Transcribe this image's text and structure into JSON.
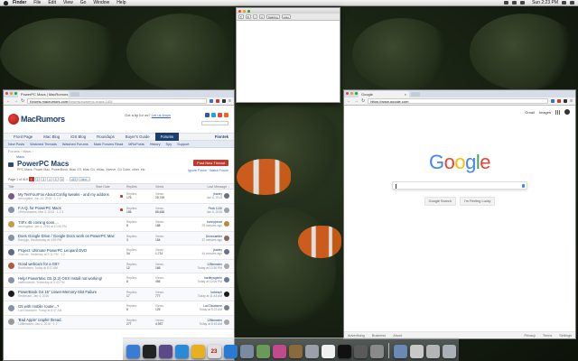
{
  "menubar": {
    "items": [
      "Finder",
      "File",
      "Edit",
      "View",
      "Go",
      "Window",
      "Help"
    ],
    "clock": "Sun 2:23 PM"
  },
  "textedit": {
    "toolbar": [
      "¶",
      "B",
      "I",
      "U",
      "Spacing",
      "Lists"
    ]
  },
  "left_browser": {
    "tab_title": "PowerPC Macs | MacRumors",
    "url_host": "forums.macrumors.com",
    "url_path": "/forums/powerpc-macs.145/",
    "site": {
      "name": "MacRumors",
      "tip_text": "Got a tip for us?",
      "tip_link": "Let us know",
      "nav_primary": [
        "Front Page",
        "Mac Blog",
        "iOS Blog",
        "Roundups",
        "Buyer's Guide",
        "Forums"
      ],
      "nav_active": "Forums",
      "user": "Finntek",
      "nav_secondary": [
        "New Posts",
        "Watched Threads",
        "Watched Forums",
        "Mark Forums Read",
        "MRoPosts",
        "History",
        "Spy",
        "Support"
      ]
    },
    "breadcrumb": "Forums › Macs ›",
    "sub_breadcrumb": "Macs",
    "forum": {
      "title": "PowerPC Macs",
      "description": "PPC Macs: Power Mac, PowerBook, iMac G3, iMac G4, eMac, Xserve, G4 Cube, other, etc.",
      "post_button": "Post New Thread",
      "ignore_link": "Ignore Forum · Watch Forum"
    },
    "pager": {
      "label": "Page 1 of 419",
      "pages": [
        "1",
        "2",
        "3",
        "4",
        "5",
        "6",
        "…",
        "419",
        "Next ›"
      ]
    },
    "table_head": [
      "Title",
      "Start Date",
      "Replies",
      "Views",
      "Last Message ↓"
    ],
    "threads": [
      {
        "title": "My TenFourFox About:Config tweaks - and my addons",
        "meta": "avuvugabd, Jun 14, 2015 · 1 2 3",
        "replies": "176",
        "views": "25,749",
        "last_user": "jbarley",
        "last_time": "Jan 6, 2013",
        "pinned": true,
        "avatar": "#7a5a8a",
        "lav": "#6a6f8a"
      },
      {
        "title": "F.A.Q. for PowerPC Macs",
        "meta": "1Rrtonoracles, Mar 3, 2013 · 1 2 3",
        "replies": "156",
        "views": "85,636",
        "last_user": "Peck 1130",
        "last_time": "Jan 5, 2015",
        "pinned": true,
        "avatar": "#8892a6",
        "lav": "#9aa3b5"
      },
      {
        "title": "T4Fx 45 coming soon....",
        "meta": "avuvugabd, Jan 4, 2016 at 10:06 PM",
        "replies": "8",
        "views": "188",
        "last_user": "bunnypecat",
        "last_time": "29 minutes ago",
        "pinned": false,
        "avatar": "#c79a4a",
        "lav": "#b58a3c"
      },
      {
        "title": "Does Google Drive / Google Docs work on PowerPC Mac",
        "meta": "Ramjuju, Wednesday at 4:59 PM",
        "replies": "3",
        "views": "154",
        "last_user": "Drcrecaetter",
        "last_time": "37 minutes ago",
        "pinned": false,
        "avatar": "#8892a6",
        "lav": "#8a6a5a"
      },
      {
        "title": "Project: Ultimate PowerPC Leopard DVD",
        "meta": "Ghovrie, Yesterday at 9:11 PM · 1 2",
        "replies": "34",
        "views": "1,714",
        "last_user": "jbarley",
        "last_time": "44 minutes ago",
        "pinned": false,
        "avatar": "#5a6a8a",
        "lav": "#6a6f8a"
      },
      {
        "title": "Good webcam for a G5?",
        "meta": "Rubthulsen, Today at 8:17 AM",
        "replies": "12",
        "views": "166",
        "last_user": "128kmaxim",
        "last_time": "Today at 12:30 PM",
        "pinned": false,
        "avatar": "#b05a3a",
        "lav": "#a8a8a8"
      },
      {
        "title": "Help! PowerMac G5 (2,2) OSX Install not working!",
        "meta": "halfbrownski, Yesterday at 5:40 PM",
        "replies": "8",
        "views": "455",
        "last_user": "hartleyagentn",
        "last_time": "Today at 12:06 PM",
        "pinned": false,
        "avatar": "#8892a6",
        "lav": "#6a7a9a"
      },
      {
        "title": "PowerBook G4 15\" Lower-Memory-Slot Failure",
        "meta": "Redbeush, Jan 4, 2016",
        "replies": "17",
        "views": "777",
        "last_user": "bobesch",
        "last_time": "Today at 11:44 AM",
        "pinned": false,
        "avatar": "#1a1a1a",
        "lav": "#1a1a1a"
      },
      {
        "title": "G5 with mobile router...?",
        "meta": "Lud Dicatavne, Today at 8:47 AM",
        "replies": "8",
        "views": "125",
        "last_user": "Lud Dicatavne",
        "last_time": "Today at 9:23 AM",
        "pinned": false,
        "avatar": "#8892a6",
        "lav": "#7a8090"
      },
      {
        "title": "'Bad Apple' crapfel thread.",
        "meta": "128kmaxim, Jan 4, 2016 · 1 2",
        "replies": "277",
        "views": "4,957",
        "last_user": "128kmaxim",
        "last_time": "Today at 8:15 AM",
        "pinned": false,
        "avatar": "#9a9a9a",
        "lav": "#a8a8a8"
      }
    ]
  },
  "right_browser": {
    "tab_title": "Google",
    "url": "https://www.google.com",
    "top_links": [
      "Gmail",
      "Images"
    ],
    "logo_letters": [
      {
        "ch": "G",
        "color": "#4285F4"
      },
      {
        "ch": "o",
        "color": "#EA4335"
      },
      {
        "ch": "o",
        "color": "#FBBC05"
      },
      {
        "ch": "g",
        "color": "#4285F4"
      },
      {
        "ch": "l",
        "color": "#34A853"
      },
      {
        "ch": "e",
        "color": "#EA4335"
      }
    ],
    "buttons": [
      "Google Search",
      "I'm Feeling Lucky"
    ],
    "footer_left": [
      "Advertising",
      "Business",
      "About"
    ],
    "footer_right": [
      "Privacy",
      "Terms",
      "Settings"
    ]
  },
  "dock": {
    "icons": [
      {
        "name": "finder-icon",
        "color": "#3a7bd5"
      },
      {
        "name": "dashboard-icon",
        "color": "#222222"
      },
      {
        "name": "mission-control-icon",
        "color": "#5a4a8a"
      },
      {
        "name": "safari-icon",
        "color": "#2a8ad5"
      },
      {
        "name": "chrome-icon",
        "color": "#e8b020"
      },
      {
        "name": "ical-icon",
        "color": "#e0e0e0"
      },
      {
        "name": "app-store-icon",
        "color": "#2a7ad5"
      },
      {
        "name": "preview-icon",
        "color": "#7a8aa0"
      },
      {
        "name": "iphoto-icon",
        "color": "#6a9a5a"
      },
      {
        "name": "itunes-icon",
        "color": "#c04a8a"
      },
      {
        "name": "garageband-icon",
        "color": "#8a6a3a"
      },
      {
        "name": "utilities-icon",
        "color": "#9aa0aa"
      },
      {
        "name": "textedit-icon",
        "color": "#f0f0f0"
      },
      {
        "name": "terminal-icon",
        "color": "#111111"
      },
      {
        "name": "activity-monitor-icon",
        "color": "#5a5a5a"
      },
      {
        "name": "system-preferences-icon",
        "color": "#8a8a8a"
      }
    ],
    "stacks": [
      {
        "name": "applications-stack-icon",
        "color": "#6a8ab5"
      },
      {
        "name": "documents-stack-icon",
        "color": "#c8c8c8"
      },
      {
        "name": "downloads-stack-icon",
        "color": "#b5b5b5"
      },
      {
        "name": "trash-icon",
        "color": "#aab0b8"
      }
    ],
    "calendar_day": "23"
  }
}
